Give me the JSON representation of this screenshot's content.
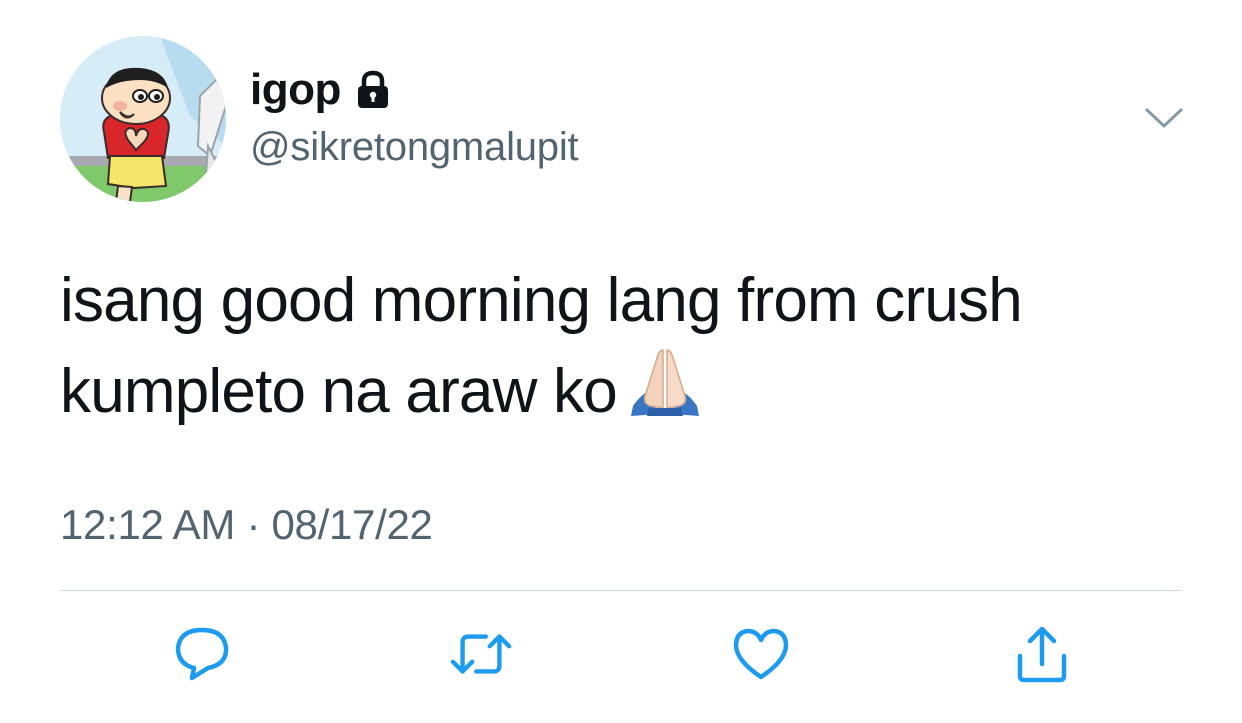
{
  "user": {
    "display_name": "igop",
    "handle": "@sikretongmalupit",
    "protected_icon": "lock-icon",
    "avatar": "shin-chan-avatar"
  },
  "tweet": {
    "text_lines": [
      "isang good morning lang from crush",
      "kumpleto na araw ko"
    ],
    "emoji": "folded-hands-emoji",
    "time": "12:12 AM",
    "separator": "·",
    "date": "08/17/22"
  },
  "actions": [
    {
      "name": "reply",
      "icon": "reply-icon"
    },
    {
      "name": "retweet",
      "icon": "retweet-icon"
    },
    {
      "name": "like",
      "icon": "heart-icon"
    },
    {
      "name": "share",
      "icon": "share-icon"
    }
  ],
  "menu_icon": "chevron-down-icon",
  "colors": {
    "text_primary": "#0f1419",
    "text_secondary": "#536471",
    "divider": "#cfd9de",
    "action_icon": "#1d9bf0"
  }
}
